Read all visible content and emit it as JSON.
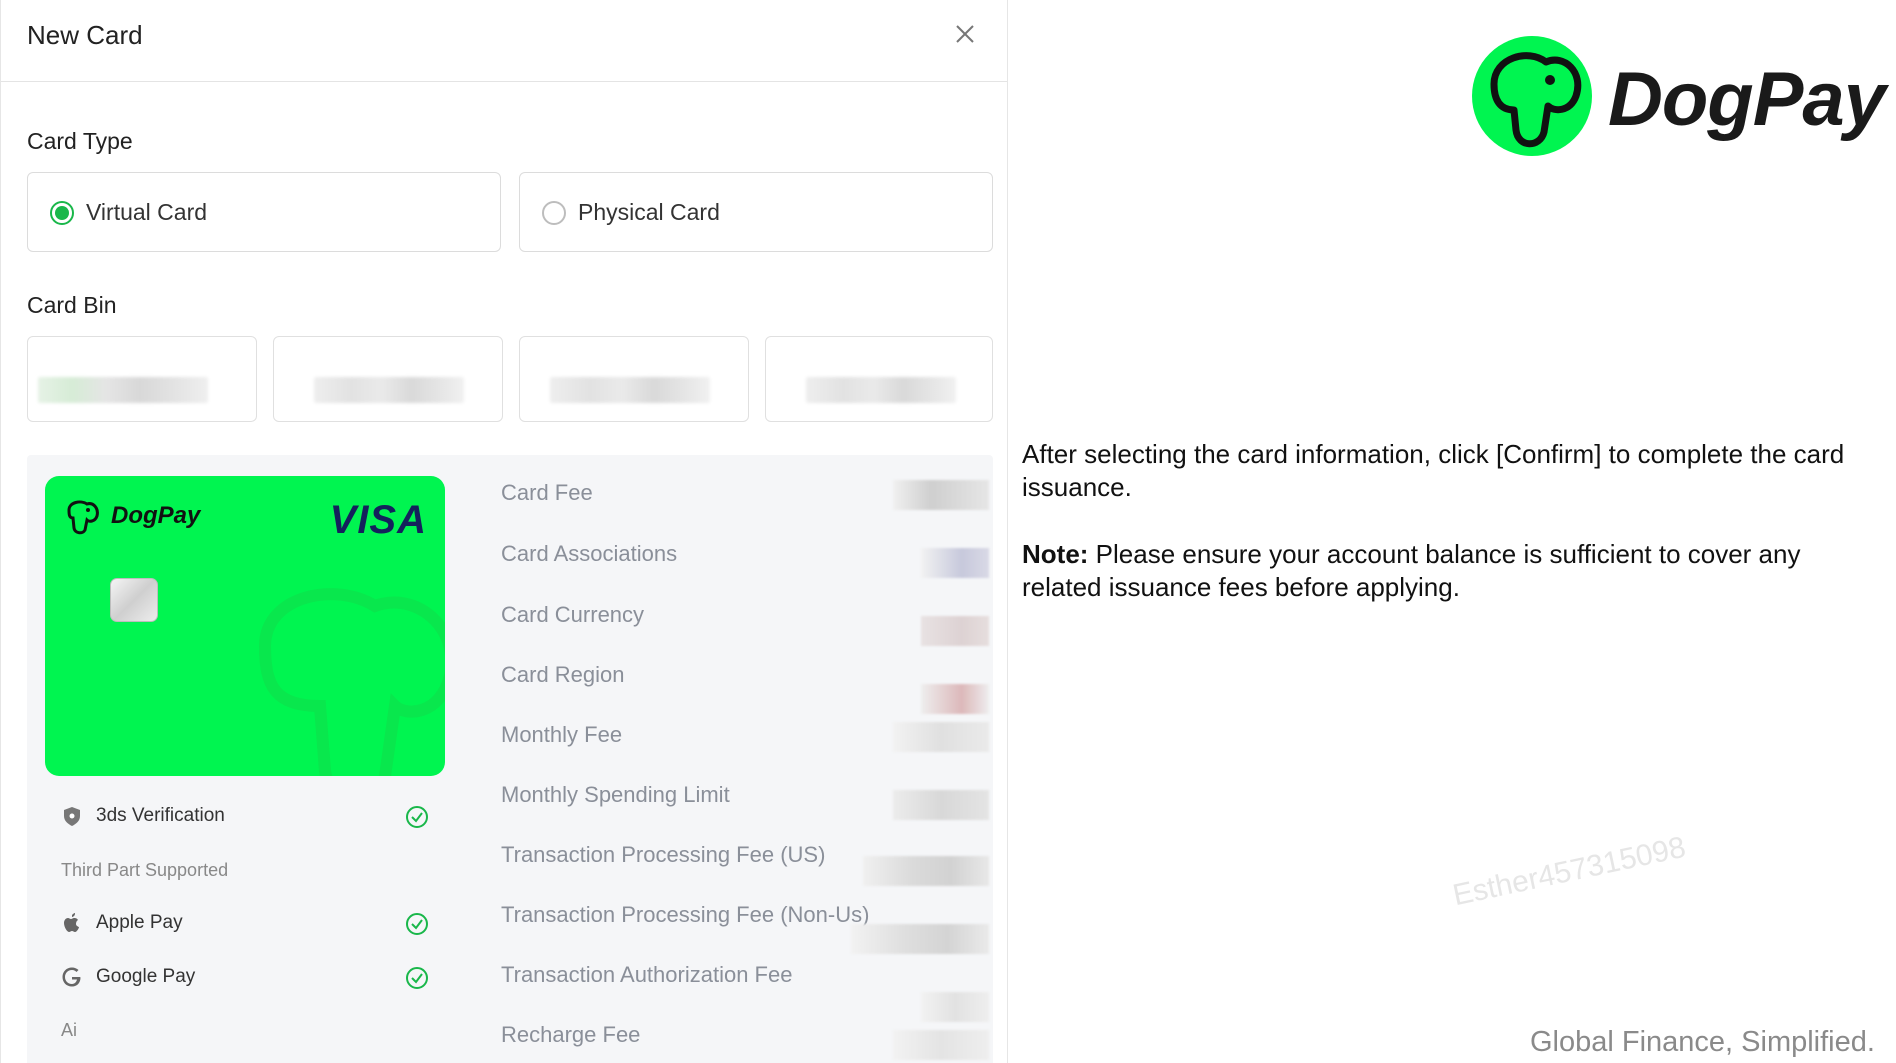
{
  "modal": {
    "title": "New Card",
    "card_type_label": "Card Type",
    "card_types": [
      {
        "label": "Virtual Card",
        "selected": true
      },
      {
        "label": "Physical Card",
        "selected": false
      }
    ],
    "card_bin_label": "Card Bin",
    "card_preview": {
      "brand": "DogPay",
      "network": "VISA",
      "color": "#00f550"
    },
    "features": {
      "verification": "3ds Verification",
      "third_party_label": "Third Part Supported",
      "apple_pay": "Apple Pay",
      "google_pay": "Google Pay",
      "ai_label": "Ai"
    },
    "fees": [
      "Card Fee",
      "Card Associations",
      "Card Currency",
      "Card Region",
      "Monthly Fee",
      "Monthly Spending Limit",
      "Transaction Processing Fee (US)",
      "Transaction Processing Fee (Non-Us)",
      "Transaction Authorization Fee",
      "Recharge Fee"
    ]
  },
  "brand": {
    "name": "DogPay",
    "accent": "#00f550"
  },
  "instructions": {
    "main": "After selecting the card information, click [Confirm] to complete the card issuance.",
    "note_label": "Note:",
    "note_text": " Please ensure your account balance is sufficient to cover any related issuance fees before applying."
  },
  "watermark": "Esther457315098",
  "tagline": "Global Finance, Simplified."
}
